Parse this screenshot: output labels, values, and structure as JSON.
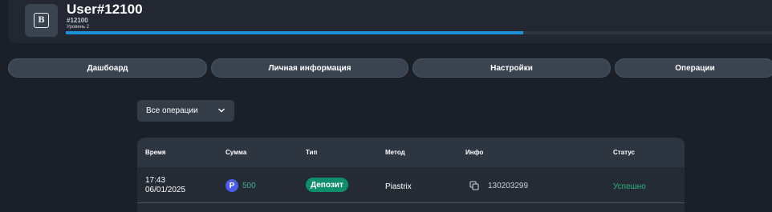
{
  "profile": {
    "username": "User#12100",
    "user_id": "#12100",
    "level": "Уровень 2",
    "avatar_letter": "B",
    "level_progress_percent": 64
  },
  "tabs": [
    {
      "label": "Дашбоард"
    },
    {
      "label": "Личная информация"
    },
    {
      "label": "Настройки"
    },
    {
      "label": "Операции"
    }
  ],
  "filter": {
    "selected": "Все операции"
  },
  "table": {
    "headers": [
      "Время",
      "Сумма",
      "Тип",
      "Метод",
      "Инфо",
      "Статус"
    ],
    "rows": [
      {
        "time": "17:43",
        "date": "06/01/2025",
        "coin_symbol": "P",
        "amount": "500",
        "type": "Депозит",
        "method": "Piastrix",
        "info": "130203299",
        "status": "Успешно"
      }
    ]
  },
  "colors": {
    "background": "#1b1f28",
    "accent_progress": "#1c90d8",
    "success": "#2fb37d",
    "deposit_badge": "#0f8e6d",
    "coin": "#4b5de8"
  }
}
